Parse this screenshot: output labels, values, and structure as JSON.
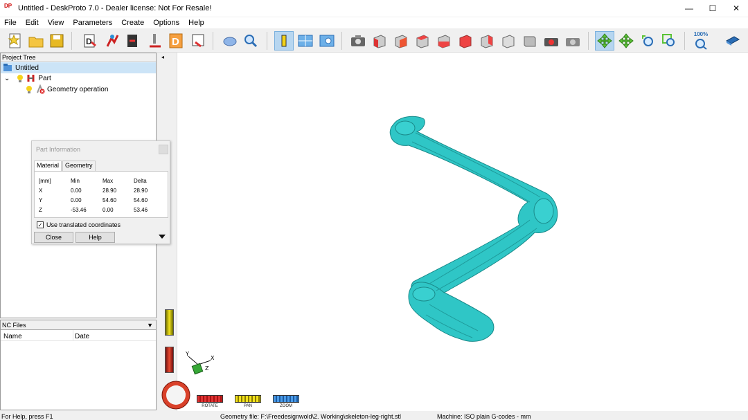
{
  "window": {
    "title": "Untitled - DeskProto 7.0 - Dealer license: Not For Resale!",
    "logo_text": "DP",
    "controls": [
      "—",
      "☐",
      "✕"
    ]
  },
  "menu": [
    "File",
    "Edit",
    "View",
    "Parameters",
    "Create",
    "Options",
    "Help"
  ],
  "toolbar": {
    "zoom_percent_label": "100%"
  },
  "project_tree": {
    "header": "Project Tree",
    "items": [
      {
        "label": "Untitled"
      },
      {
        "label": "Part"
      },
      {
        "label": "Geometry operation"
      }
    ]
  },
  "part_info": {
    "title": "Part Information",
    "tabs": [
      "Material",
      "Geometry"
    ],
    "columns": [
      "[mm]",
      "Min",
      "Max",
      "Delta"
    ],
    "rows": [
      [
        "X",
        "0.00",
        "28.90",
        "28.90"
      ],
      [
        "Y",
        "0.00",
        "54.60",
        "54.60"
      ],
      [
        "Z",
        "-53.46",
        "0.00",
        "53.46"
      ]
    ],
    "checkbox_label": "Use translated coordinates",
    "checkbox_checked": true,
    "close_label": "Close",
    "help_label": "Help"
  },
  "nc_files": {
    "header": "NC Files",
    "columns": [
      "Name",
      "Date"
    ]
  },
  "viewport": {
    "model_color": "#2fc6c6",
    "axis_labels": {
      "x": "X",
      "y": "Y",
      "z": "Z"
    },
    "nav_labels": [
      "ROTATE",
      "PAN",
      "ZOOM"
    ]
  },
  "status": {
    "help": "For Help, press F1",
    "geometry_file": "Geometry file: F:\\Freedesignwold\\2. Working\\skeleton-leg-right.stl",
    "machine": "Machine: ISO plain G-codes - mm"
  }
}
